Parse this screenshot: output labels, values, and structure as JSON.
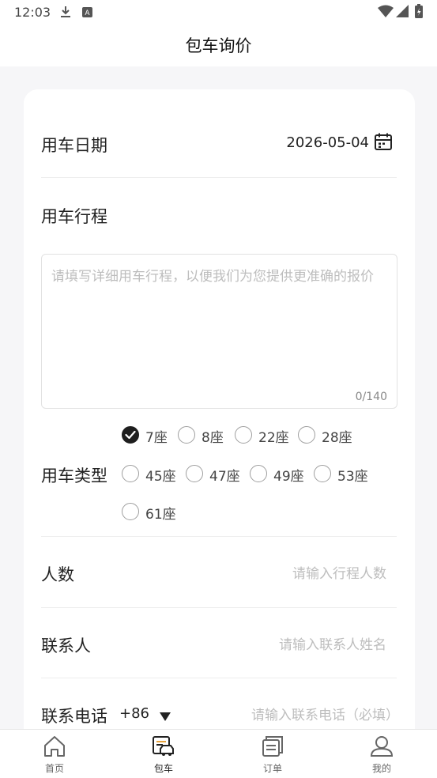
{
  "status_bar": {
    "time": "12:03"
  },
  "header": {
    "title": "包车询价"
  },
  "form": {
    "date_label": "用车日期",
    "date_value": "2026-05-04",
    "trip_label": "用车行程",
    "trip_placeholder": "请填写详细用车行程，以便我们为您提供更准确的报价",
    "trip_counter": "0/140",
    "type_label": "用车类型",
    "seat_options": [
      {
        "label": "7座",
        "checked": true
      },
      {
        "label": "8座",
        "checked": false
      },
      {
        "label": "22座",
        "checked": false
      },
      {
        "label": "28座",
        "checked": false
      },
      {
        "label": "45座",
        "checked": false
      },
      {
        "label": "47座",
        "checked": false
      },
      {
        "label": "49座",
        "checked": false
      },
      {
        "label": "53座",
        "checked": false
      },
      {
        "label": "61座",
        "checked": false
      }
    ],
    "people_label": "人数",
    "people_placeholder": "请输入行程人数",
    "contact_label": "联系人",
    "contact_placeholder": "请输入联系人姓名",
    "phone_label": "联系电话",
    "phone_code": "+86",
    "phone_placeholder": "请输入联系电话（必填）"
  },
  "nav": [
    {
      "label": "首页",
      "icon": "home-icon",
      "active": false
    },
    {
      "label": "包车",
      "icon": "bus-icon",
      "active": true
    },
    {
      "label": "订单",
      "icon": "orders-icon",
      "active": false
    },
    {
      "label": "我的",
      "icon": "profile-icon",
      "active": false
    }
  ],
  "colors": {
    "accent": "#1e1e1e",
    "placeholder": "#bdbdbd",
    "background": "#f6f6f8"
  }
}
